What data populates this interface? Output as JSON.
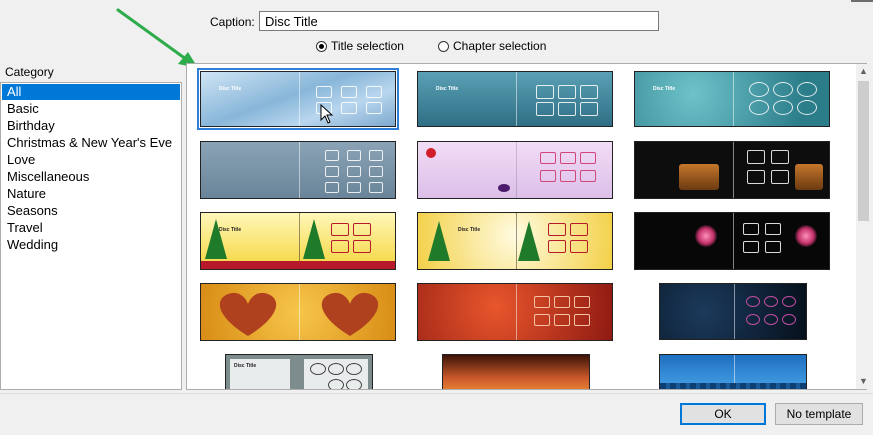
{
  "caption": {
    "label": "Caption:",
    "value": "Disc Title"
  },
  "modes": [
    {
      "label": "Title selection",
      "selected": true
    },
    {
      "label": "Chapter selection",
      "selected": false
    }
  ],
  "category": {
    "label": "Category",
    "items": [
      "All",
      "Basic",
      "Birthday",
      "Christmas & New Year's Eve",
      "Love",
      "Miscellaneous",
      "Nature",
      "Seasons",
      "Travel",
      "Wedding"
    ],
    "selected": "All"
  },
  "templates": [
    {
      "name": "blue-waves",
      "theme_color": "#7fb0d8",
      "disc_title": "Disc Title",
      "selected": true
    },
    {
      "name": "teal-frame",
      "theme_color": "#3c7f96",
      "disc_title": "Disc Title",
      "selected": false
    },
    {
      "name": "teal-ovals",
      "theme_color": "#3f9aa6",
      "disc_title": "Disc Title",
      "selected": false
    },
    {
      "name": "grey-blue",
      "theme_color": "#6f8aa1",
      "selected": false
    },
    {
      "name": "party-lilac",
      "theme_color": "#e4c8ee",
      "selected": false
    },
    {
      "name": "birthday-cake",
      "theme_color": "#111111",
      "selected": false
    },
    {
      "name": "christmas-yellow",
      "theme_color": "#f2d84a",
      "disc_title": "Disc Title",
      "selected": false
    },
    {
      "name": "christmas-yellow-2",
      "theme_color": "#f2d84a",
      "disc_title": "Disc Title",
      "selected": false
    },
    {
      "name": "fireworks-dark",
      "theme_color": "#0b0b0b",
      "selected": false
    },
    {
      "name": "gold-hearts",
      "theme_color": "#e0a21d",
      "selected": false
    },
    {
      "name": "red-hearts",
      "theme_color": "#b6321e",
      "selected": false
    },
    {
      "name": "dark-blue-swirl",
      "theme_color": "#0d1a2b",
      "selected": false
    },
    {
      "name": "grey-frames",
      "theme_color": "#8c9a9a",
      "disc_title": "Disc Title",
      "selected": false
    },
    {
      "name": "sunset",
      "theme_color": "#c9582a",
      "selected": false
    },
    {
      "name": "city-blue",
      "theme_color": "#2a86d0",
      "selected": false
    }
  ],
  "buttons": {
    "ok": "OK",
    "no_template": "No template"
  },
  "colors": {
    "accent": "#0078d7",
    "arrow": "#2eab4b"
  }
}
